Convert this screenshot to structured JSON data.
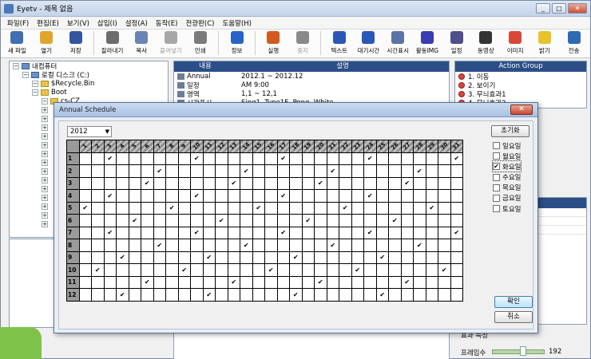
{
  "window": {
    "title": "Eyetv - 제목 없음",
    "buttons": [
      "_",
      "□",
      "✕"
    ]
  },
  "menu": [
    "파일(F)",
    "편집(E)",
    "보기(V)",
    "삽입(I)",
    "설정(A)",
    "동작(E)",
    "전광판(C)",
    "도움말(H)"
  ],
  "toolbar": [
    {
      "label": "새 파일",
      "icon": "new-file-icon",
      "color": "#3f6fb0"
    },
    {
      "label": "열기",
      "icon": "open-folder-icon",
      "color": "#e0a62c"
    },
    {
      "label": "저장",
      "icon": "save-icon",
      "color": "#3455a0"
    },
    {
      "label": "잘라내기",
      "icon": "cut-icon",
      "color": "#6c6c6c"
    },
    {
      "label": "복사",
      "icon": "copy-icon",
      "color": "#6b84b6"
    },
    {
      "label": "붙여넣기",
      "icon": "paste-icon",
      "color": "#a7a7a7",
      "disabled": true
    },
    {
      "label": "인쇄",
      "icon": "print-icon",
      "color": "#7b7b7b"
    },
    {
      "label": "정보",
      "icon": "info-icon",
      "color": "#2a63c8"
    },
    {
      "label": "실행",
      "icon": "run-icon",
      "color": "#d35a1f"
    },
    {
      "label": "중지",
      "icon": "stop-icon",
      "color": "#8a8a8a",
      "disabled": true
    },
    {
      "label": "텍스트",
      "icon": "text-icon",
      "color": "#2a58b8"
    },
    {
      "label": "대기시간",
      "icon": "wait-time-icon",
      "color": "#2a58b8"
    },
    {
      "label": "시간표시",
      "icon": "time-display-icon",
      "color": "#5a74a8"
    },
    {
      "label": "활동IMG",
      "icon": "activity-img-icon",
      "color": "#3b3bb3"
    },
    {
      "label": "일정",
      "icon": "schedule-icon",
      "color": "#4e4e8a"
    },
    {
      "label": "동영상",
      "icon": "video-icon",
      "color": "#333333"
    },
    {
      "label": "이미지",
      "icon": "image-icon",
      "color": "#d9473b"
    },
    {
      "label": "밝기",
      "icon": "brightness-icon",
      "color": "#e6c32c"
    },
    {
      "label": "전송",
      "icon": "send-icon",
      "color": "#2d6ab3"
    }
  ],
  "tree": [
    {
      "label": "내컴퓨터",
      "indent": 0,
      "type": "pc"
    },
    {
      "label": "로컬 디스크 (C:)",
      "indent": 1,
      "type": "disk"
    },
    {
      "label": "$Recycle.Bin",
      "indent": 2,
      "type": "folder"
    },
    {
      "label": "Boot",
      "indent": 2,
      "type": "folder"
    },
    {
      "label": "cs-CZ",
      "indent": 3,
      "type": "folder"
    }
  ],
  "props": {
    "headers": [
      "내용",
      "설명"
    ],
    "rows": [
      {
        "name": "Annual",
        "value": "2012.1 ~ 2012.12"
      },
      {
        "name": "일정",
        "value": "AM 9:00"
      },
      {
        "name": "영역",
        "value": "1,1 ~ 12,1"
      },
      {
        "name": "시간표시",
        "value": "Sing1, Type1F, Pong, White"
      }
    ]
  },
  "actions": {
    "header": "Action Group",
    "items": [
      "1. 이동",
      "2. 보이기",
      "3. 무늬효과1",
      "4. 무늬효과2"
    ]
  },
  "effect_label": "효과 특성",
  "frame": {
    "label": "프레임수",
    "value": "192"
  },
  "dialog": {
    "title": "Annual Schedule",
    "close": "✕",
    "year": "2012",
    "reset": "초기화",
    "ok": "확인",
    "cancel": "취소",
    "weekdays": [
      {
        "label": "일요일",
        "checked": false
      },
      {
        "label": "월요일",
        "checked": false
      },
      {
        "label": "화요일",
        "checked": true
      },
      {
        "label": "수요일",
        "checked": false
      },
      {
        "label": "목요일",
        "checked": false
      },
      {
        "label": "금요일",
        "checked": false
      },
      {
        "label": "토요일",
        "checked": false
      }
    ],
    "days": [
      "1",
      "2",
      "3",
      "4",
      "5",
      "6",
      "7",
      "8",
      "9",
      "10",
      "11",
      "12",
      "13",
      "14",
      "15",
      "16",
      "17",
      "18",
      "19",
      "20",
      "21",
      "22",
      "23",
      "24",
      "25",
      "26",
      "27",
      "28",
      "29",
      "30",
      "31"
    ],
    "months": [
      "1",
      "2",
      "3",
      "4",
      "5",
      "6",
      "7",
      "8",
      "9",
      "10",
      "11",
      "12"
    ],
    "checked_days": {
      "1": [
        3,
        10,
        17,
        24,
        31
      ],
      "2": [
        7,
        14,
        21,
        28
      ],
      "3": [
        6,
        13,
        20,
        27
      ],
      "4": [
        3,
        10,
        17,
        24
      ],
      "5": [
        1,
        8,
        15,
        22,
        29
      ],
      "6": [
        5,
        12,
        19,
        26
      ],
      "7": [
        3,
        10,
        17,
        24,
        31
      ],
      "8": [
        7,
        14,
        21,
        28
      ],
      "9": [
        4,
        11,
        18,
        25
      ],
      "10": [
        2,
        9,
        16,
        23,
        30
      ],
      "11": [
        6,
        13,
        20,
        27
      ],
      "12": [
        4,
        11,
        18,
        25
      ]
    }
  }
}
